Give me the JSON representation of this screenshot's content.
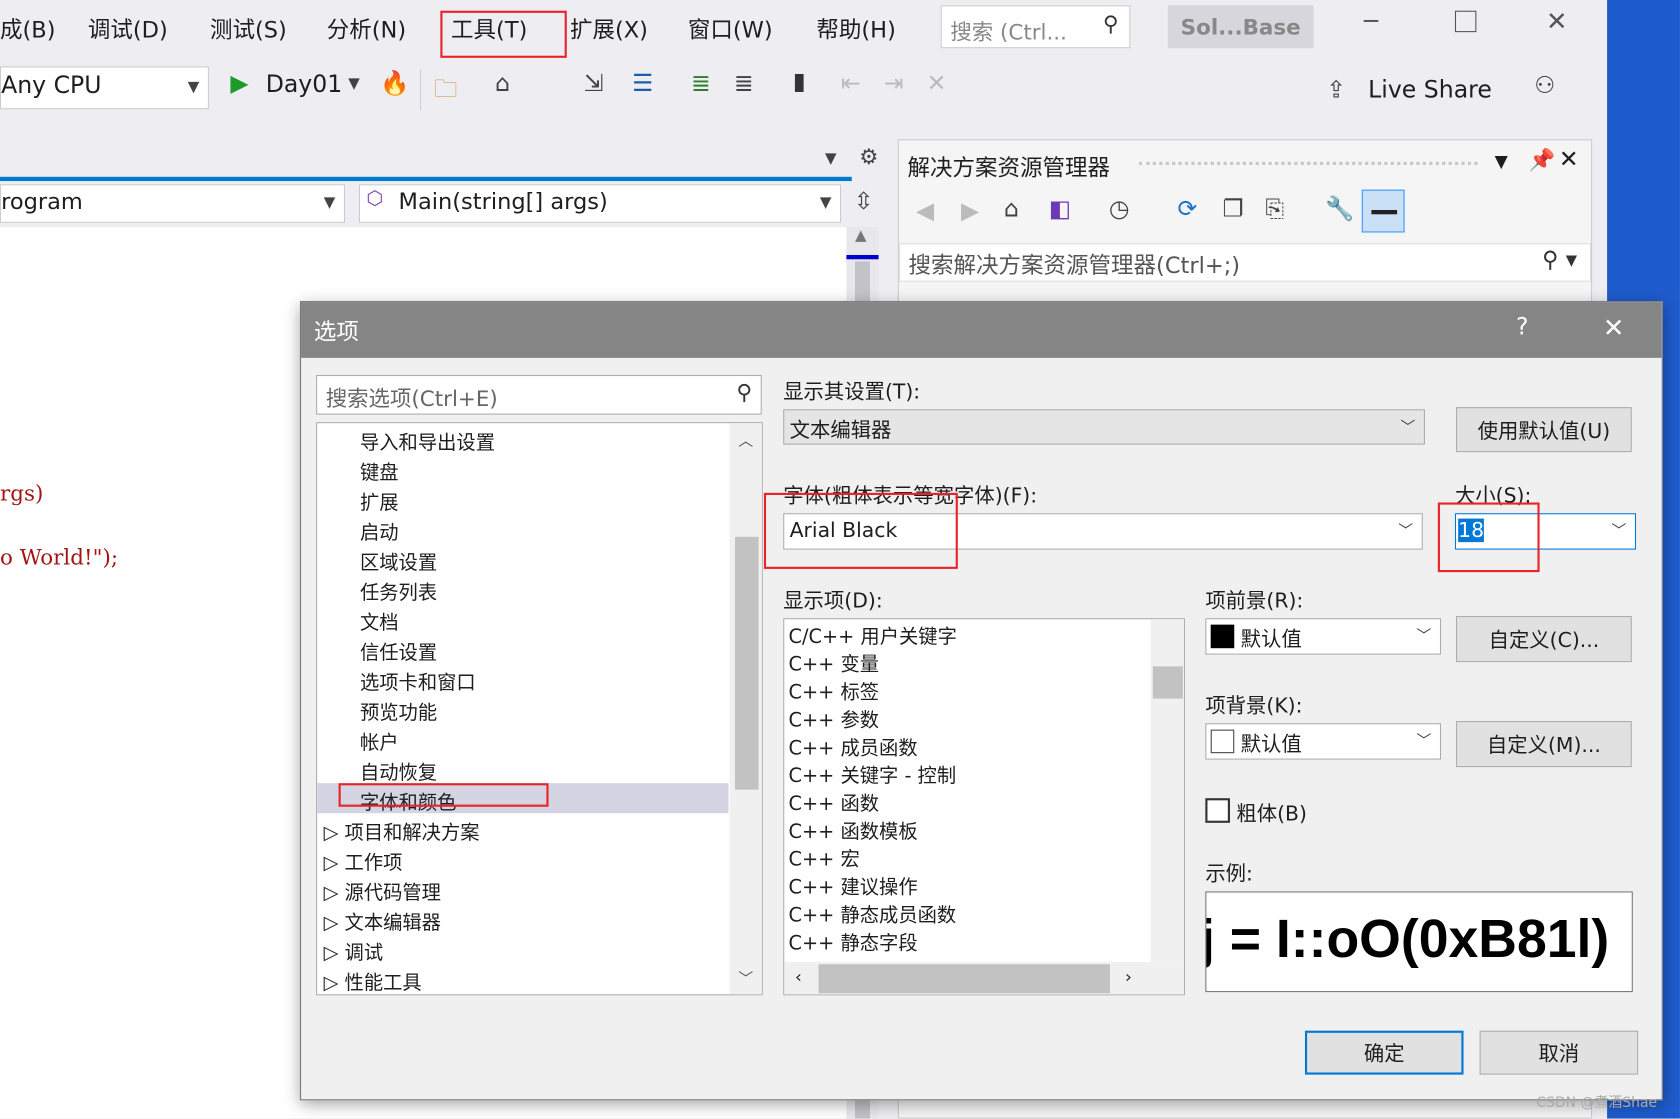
{
  "menu": {
    "items": [
      "成(B)",
      "调试(D)",
      "测试(S)",
      "分析(N)",
      "工具(T)",
      "扩展(X)",
      "窗口(W)",
      "帮助(H)"
    ],
    "search_placeholder": "搜索 (Ctrl...",
    "solution_badge": "Sol...Base"
  },
  "toolbar": {
    "platform": "Any CPU",
    "start_project": "Day01",
    "live_share": "Live Share"
  },
  "editor": {
    "class_dropdown": "rogram",
    "member_dropdown": "Main(string[] args)",
    "code_lines": [
      "rgs)",
      "o World!\");"
    ],
    "code_color": "#a31515"
  },
  "solution_explorer": {
    "title": "解决方案资源管理器",
    "search_placeholder": "搜索解决方案资源管理器(Ctrl+;)"
  },
  "dialog": {
    "title": "选项",
    "help": "?",
    "search_placeholder": "搜索选项(Ctrl+E)",
    "tree_children": [
      "导入和导出设置",
      "键盘",
      "扩展",
      "启动",
      "区域设置",
      "任务列表",
      "文档",
      "信任设置",
      "选项卡和窗口",
      "预览功能",
      "帐户",
      "自动恢复",
      "字体和颜色"
    ],
    "tree_selected": "字体和颜色",
    "tree_groups": [
      "项目和解决方案",
      "工作项",
      "源代码管理",
      "文本编辑器",
      "调试",
      "性能工具"
    ],
    "show_settings_label": "显示其设置(T):",
    "show_settings_value": "文本编辑器",
    "use_defaults": "使用默认值(U)",
    "font_label": "字体(粗体表示等宽字体)(F):",
    "font_value": "Arial Black",
    "size_label": "大小(S):",
    "size_value": "18",
    "display_items_label": "显示项(D):",
    "display_items": [
      "C/C++ 用户关键字",
      "C++ 变量",
      "C++ 标签",
      "C++ 参数",
      "C++ 成员函数",
      "C++ 关键字 - 控制",
      "C++ 函数",
      "C++ 函数模板",
      "C++ 宏",
      "C++ 建议操作",
      "C++ 静态成员函数",
      "C++ 静态字段"
    ],
    "foreground_label": "项前景(R):",
    "foreground_value": "默认值",
    "foreground_swatch": "#000000",
    "custom_fg": "自定义(C)...",
    "background_label": "项背景(K):",
    "background_value": "默认值",
    "background_swatch": "#ffffff",
    "custom_bg": "自定义(M)...",
    "bold_label": "粗体(B)",
    "bold_checked": false,
    "sample_label": "示例:",
    "sample_text": "j = I::oO(0xB81l)",
    "ok": "确定",
    "cancel": "取消"
  },
  "watermark": "CSDN @煮酒Shae",
  "colors": {
    "accent": "#007acc",
    "highlight_box": "#e8242a",
    "selection": "#0078d7"
  }
}
